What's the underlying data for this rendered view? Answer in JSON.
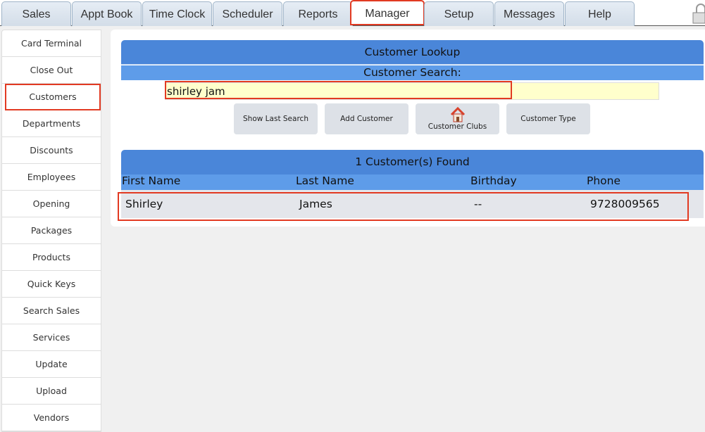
{
  "tabs": [
    "Sales",
    "Appt Book",
    "Time Clock",
    "Scheduler",
    "Reports",
    "Manager",
    "Setup",
    "Messages",
    "Help"
  ],
  "active_tab": "Manager",
  "sidebar": [
    "Card Terminal",
    "Close Out",
    "Customers",
    "Departments",
    "Discounts",
    "Employees",
    "Opening",
    "Packages",
    "Products",
    "Quick Keys",
    "Search Sales",
    "Services",
    "Update",
    "Upload",
    "Vendors"
  ],
  "selected_sidebar": "Customers",
  "lookup": {
    "title": "Customer Lookup",
    "search_label": "Customer Search:",
    "search_value": "shirley jam",
    "buttons": [
      "Show Last Search",
      "Add Customer",
      "Customer Clubs",
      "Customer Type"
    ]
  },
  "results": {
    "title": "1 Customer(s) Found",
    "columns": [
      "First Name",
      "Last Name",
      "Birthday",
      "Phone"
    ],
    "rows": [
      [
        "Shirley",
        "James",
        "--",
        "9728009565"
      ]
    ]
  },
  "colors": {
    "header": "#4a86d9",
    "subheader": "#5e9ce9",
    "highlight": "#e23a22",
    "input_bg": "#ffffcc"
  },
  "icons": {
    "customer_clubs": "house-icon",
    "top_right": "lock-icon"
  }
}
